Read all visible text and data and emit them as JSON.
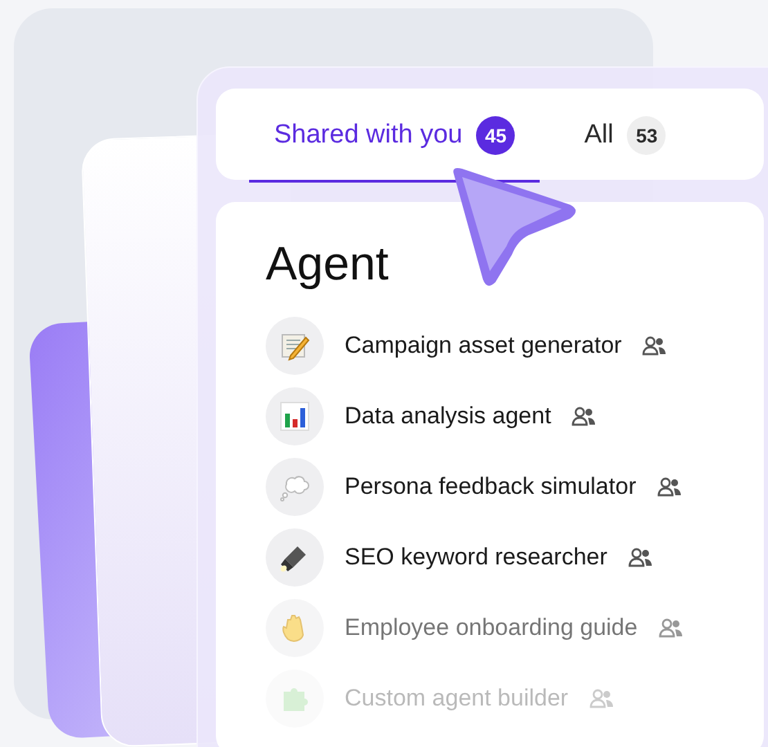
{
  "tabs": [
    {
      "label": "Shared with you",
      "count": "45",
      "selected": true
    },
    {
      "label": "All",
      "count": "53",
      "selected": false
    }
  ],
  "section": {
    "title": "Agent"
  },
  "agents": [
    {
      "name": "Campaign asset generator",
      "kind": "memo",
      "shared": true,
      "dimmed": false
    },
    {
      "name": "Data analysis agent",
      "kind": "chart",
      "shared": true,
      "dimmed": false
    },
    {
      "name": "Persona feedback simulator",
      "kind": "thought",
      "shared": true,
      "dimmed": false
    },
    {
      "name": "SEO keyword researcher",
      "kind": "flashlight",
      "shared": true,
      "dimmed": false
    },
    {
      "name": "Employee onboarding guide",
      "kind": "wave",
      "shared": true,
      "dimmed": true
    },
    {
      "name": "Custom agent builder",
      "kind": "puzzle",
      "shared": true,
      "dimmed": true
    }
  ]
}
